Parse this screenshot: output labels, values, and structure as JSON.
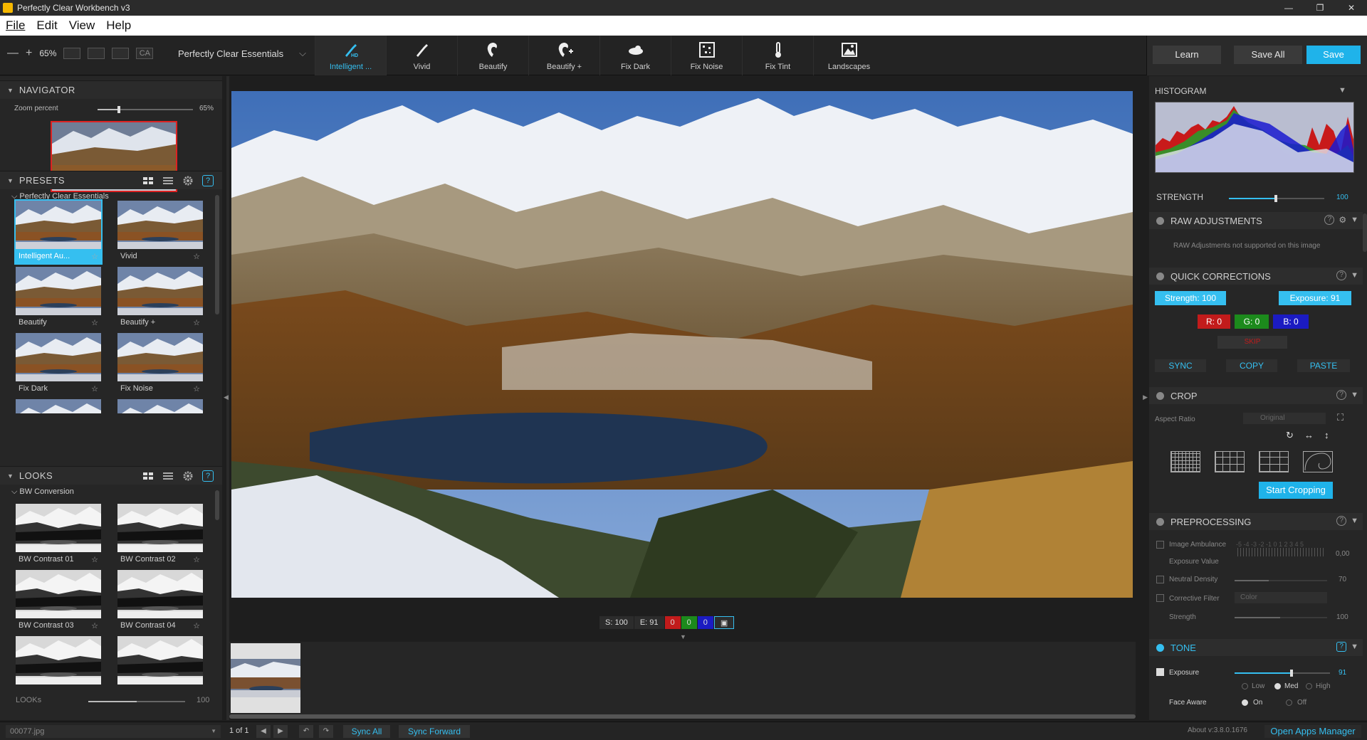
{
  "window": {
    "title": "Perfectly Clear Workbench v3",
    "controls": [
      "—",
      "❐",
      "✕"
    ]
  },
  "menu": [
    "File",
    "Edit",
    "View",
    "Help"
  ],
  "toolbar": {
    "zoom_minus": "—",
    "zoom_plus": "+",
    "zoom": "65%",
    "ca_label": "CA",
    "preset_dropdown": "Perfectly Clear Essentials",
    "tools": [
      {
        "label": "Intelligent ...",
        "icon": "intelligent-auto-hd-icon",
        "active": true
      },
      {
        "label": "Vivid",
        "icon": "brush-icon",
        "active": false
      },
      {
        "label": "Beautify",
        "icon": "face-icon",
        "active": false
      },
      {
        "label": "Beautify +",
        "icon": "face-plus-icon",
        "active": false
      },
      {
        "label": "Fix Dark",
        "icon": "cloud-icon",
        "active": false
      },
      {
        "label": "Fix Noise",
        "icon": "noise-icon",
        "active": false
      },
      {
        "label": "Fix Tint",
        "icon": "thermometer-icon",
        "active": false
      },
      {
        "label": "Landscapes",
        "icon": "landscape-icon",
        "active": false
      }
    ],
    "learn": "Learn",
    "save_all": "Save All",
    "save": "Save"
  },
  "navigator": {
    "title": "NAVIGATOR",
    "zoom_label": "Zoom percent",
    "zoom_value": "65%",
    "zoom_fraction": 0.22
  },
  "presets": {
    "title": "PRESETS",
    "group": "Perfectly Clear Essentials",
    "items": [
      "Intelligent Au...",
      "Vivid",
      "Beautify",
      "Beautify +",
      "Fix Dark",
      "Fix Noise"
    ]
  },
  "looks": {
    "title": "LOOKS",
    "group": "BW Conversion",
    "items": [
      "BW Contrast 01",
      "BW Contrast 02",
      "BW Contrast 03",
      "BW Contrast 04"
    ],
    "footer_label": "LOOKs",
    "footer_value": "100"
  },
  "image_status": {
    "strength": "S: 100",
    "exposure": "E: 91",
    "r": "0",
    "g": "0",
    "b": "0"
  },
  "right": {
    "histogram_title": "HISTOGRAM",
    "strength_label": "STRENGTH",
    "strength_value": "100",
    "raw_title": "RAW ADJUSTMENTS",
    "raw_note": "RAW Adjustments not supported on this image",
    "qc_title": "QUICK CORRECTIONS",
    "qc_strength": "Strength: 100",
    "qc_exposure": "Exposure: 91",
    "qc_r": "R: 0",
    "qc_g": "G: 0",
    "qc_b": "B: 0",
    "qc_skip": "SKIP",
    "qc_sync": "SYNC",
    "qc_copy": "COPY",
    "qc_paste": "PASTE",
    "crop_title": "CROP",
    "aspect_label": "Aspect Ratio",
    "aspect_value": "Original",
    "start_crop": "Start Cropping",
    "pre_title": "PREPROCESSING",
    "image_ambulance": "Image Ambulance",
    "ambulance_scale": "-5 -4 -3 -2 -1  0  1  2  3  4  5",
    "exposure_value_label": "Exposure Value",
    "exposure_value": "0,00",
    "neutral_density": "Neutral Density",
    "neutral_density_value": "70",
    "corrective_filter": "Corrective Filter",
    "corrective_filter_value": "Color",
    "pre_strength_label": "Strength",
    "pre_strength_value": "100",
    "tone_title": "TONE",
    "exposure_label": "Exposure",
    "exposure_val": "91",
    "low": "Low",
    "med": "Med",
    "high": "High",
    "face_aware": "Face Aware",
    "on": "On",
    "off": "Off"
  },
  "bottom": {
    "file": "00077.jpg",
    "count": "1 of 1",
    "sync_all": "Sync All",
    "sync_forward": "Sync Forward",
    "about": "About v:3.8.0.1676",
    "open_apps": "Open Apps Manager"
  },
  "colors": {
    "accent": "#35bff0",
    "red": "#d41a1a",
    "green": "#1a8a1a",
    "blue": "#1a1acc"
  }
}
